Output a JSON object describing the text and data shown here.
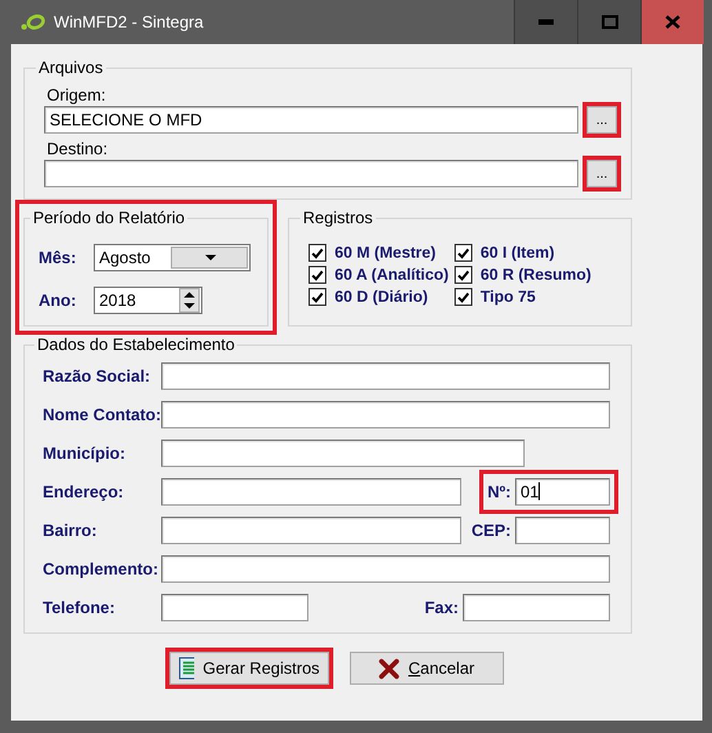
{
  "window": {
    "title": "WinMFD2 - Sintegra"
  },
  "arquivos": {
    "title": "Arquivos",
    "fields": [
      {
        "label": "Origem:",
        "value": "SELECIONE O MFD",
        "browse_button": "...",
        "highlighted": true
      },
      {
        "label": "Destino:",
        "browse_button": "...",
        "highlighted": true
      }
    ]
  },
  "periodo": {
    "title": "Período do Relatório",
    "highlighted": true,
    "month_label": "Mês:",
    "month": "Agosto",
    "year_label": "Ano:",
    "year": "2018"
  },
  "registros": {
    "title": "Registros",
    "items": [
      {
        "label": "60 M (Mestre)",
        "checked": true
      },
      {
        "label": "60 I (Item)",
        "checked": true
      },
      {
        "label": "60 A (Analítico)",
        "checked": true
      },
      {
        "label": "60 R (Resumo)",
        "checked": true
      },
      {
        "label": "60 D (Diário)",
        "checked": true
      },
      {
        "label": "Tipo 75",
        "checked": true
      }
    ]
  },
  "dados": {
    "title": "Dados do Estabelecimento",
    "rows": [
      [
        {
          "label": "Razão Social:"
        }
      ],
      [
        {
          "label": "Nome Contato:"
        }
      ],
      [
        {
          "label": "Município:"
        }
      ],
      [
        {
          "label": "Endereço:"
        },
        {
          "label": "Nº:",
          "value": "01",
          "highlighted": true,
          "focused": true
        }
      ],
      [
        {
          "label": "Bairro:"
        },
        {
          "label": "CEP:"
        }
      ],
      [
        {
          "label": "Complemento:"
        }
      ],
      [
        {
          "label": "Telefone:"
        },
        {
          "label": "Fax:"
        }
      ]
    ]
  },
  "buttons": [
    {
      "kind": "generate",
      "label": "Gerar Registros",
      "highlighted": true
    },
    {
      "kind": "cancel",
      "label": "Cancelar",
      "underline_first": true,
      "highlighted": false
    }
  ]
}
